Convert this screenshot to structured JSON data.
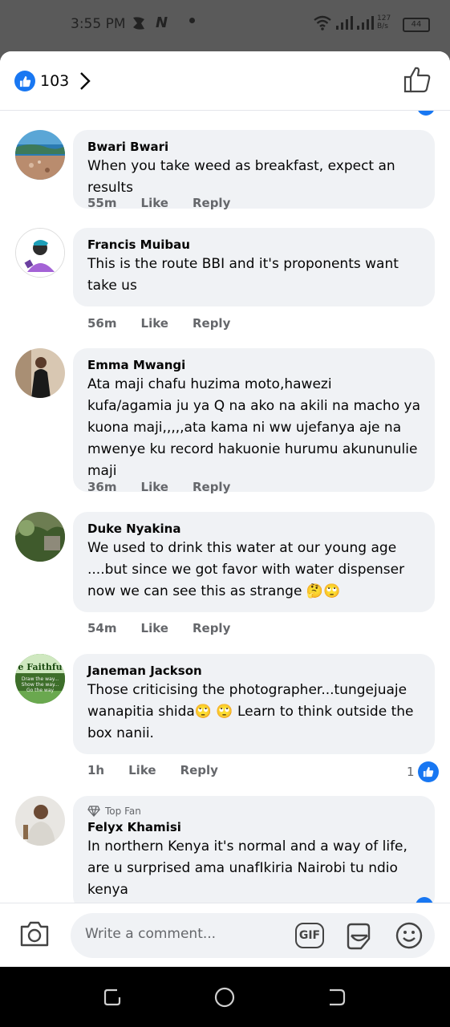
{
  "status_bar": {
    "time": "3:55 PM",
    "net_speed": "127\nB/s",
    "battery": "44"
  },
  "header": {
    "reaction_count": "103"
  },
  "comments": [
    {
      "author": "Bwari Bwari",
      "text": "When you take weed as breakfast, expect an results",
      "time": "55m",
      "like": "Like",
      "reply": "Reply"
    },
    {
      "author": "Francis Muibau",
      "text": "This is the route BBI and it's proponents want take us",
      "time": "56m",
      "like": "Like",
      "reply": "Reply"
    },
    {
      "author": "Emma Mwangi",
      "text": "Ata maji chafu huzima moto,hawezi kufa/agamia ju ya Q na ako na akili na macho ya kuona maji,,,,,ata kama ni ww ujefanya aje na mwenye ku record hakuonie hurumu akununulie maji",
      "time": "36m",
      "like": "Like",
      "reply": "Reply"
    },
    {
      "author": "Duke Nyakina",
      "text": "We used to drink this water at our young age ....but since we got favor with water dispenser now we can see this as strange 🤔🙄",
      "time": "54m",
      "like": "Like",
      "reply": "Reply"
    },
    {
      "author": "Janeman Jackson",
      "text": "Those criticising the photographer...tungejuaje wanapitia shida🙄 🙄 Learn to think outside the box nanii.",
      "time": "1h",
      "like": "Like",
      "reply": "Reply",
      "reactions": "1",
      "avatar_text": "e Faithfu",
      "avatar_subtext": "Draw the way... Show the way... Go the way"
    },
    {
      "badge": "Top Fan",
      "author": "Felyx Khamisi",
      "text": "In northern Kenya it's normal and a way of life, are u surprised ama unafIkiria Nairobi tu ndio kenya"
    }
  ],
  "composer": {
    "placeholder": "Write a comment...",
    "gif_label": "GIF"
  },
  "colors": {
    "facebook_blue": "#1877f2",
    "bubble_bg": "#f0f2f5",
    "meta_text": "#65676b"
  }
}
